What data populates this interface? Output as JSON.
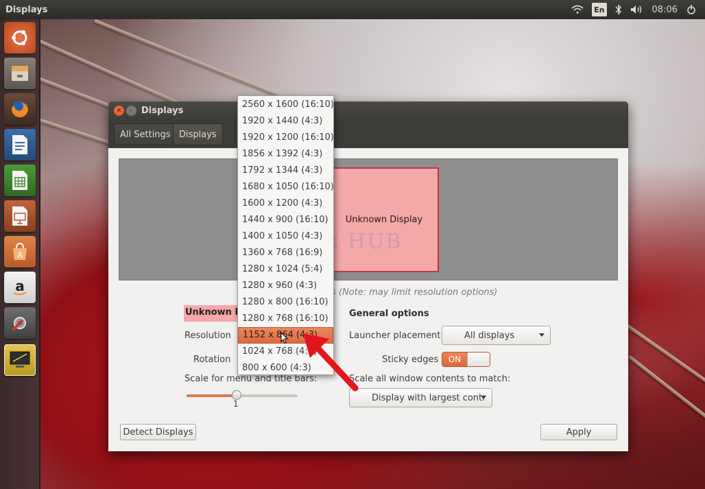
{
  "top_panel": {
    "title": "Displays",
    "language": "En",
    "clock": "08:06",
    "tray_icons": [
      "wifi-icon",
      "bluetooth-icon",
      "volume-icon",
      "settings-gear-icon"
    ]
  },
  "launcher": {
    "items": [
      "ubuntu-dash-icon",
      "files-icon",
      "firefox-icon",
      "writer-icon",
      "calc-icon",
      "impress-icon",
      "software-center-icon",
      "amazon-icon",
      "system-settings-icon",
      "displays-app-icon"
    ]
  },
  "window": {
    "title": "Displays",
    "breadcrumb": {
      "all_settings": "All Settings",
      "current": "Displays"
    },
    "monitor_label": "Unknown Display",
    "watermark": "IT Pros HUB",
    "note": "s (Note: may limit resolution options)",
    "display_name": "Unknown Di",
    "labels": {
      "resolution": "Resolution",
      "rotation": "Rotation",
      "scale_menu": "Scale for menu and title bars:",
      "scale_value": "1",
      "general_options": "General options",
      "launcher_placement": "Launcher placement",
      "sticky_edges": "Sticky edges",
      "scale_all": "Scale all window contents to match:"
    },
    "launcher_placement_value": "All displays",
    "sticky_edges_value": "ON",
    "scale_all_value": "Display with largest contr",
    "buttons": {
      "detect": "Detect Displays",
      "apply": "Apply"
    }
  },
  "resolution_dropdown": {
    "options": [
      "2560 x 1600 (16:10)",
      "1920 x 1440 (4:3)",
      "1920 x 1200 (16:10)",
      "1856 x 1392 (4:3)",
      "1792 x 1344 (4:3)",
      "1680 x 1050 (16:10)",
      "1600 x 1200 (4:3)",
      "1440 x 900 (16:10)",
      "1400 x 1050 (4:3)",
      "1360 x 768 (16:9)",
      "1280 x 1024 (5:4)",
      "1280 x 960 (4:3)",
      "1280 x 800 (16:10)",
      "1280 x 768 (16:10)",
      "1152 x 864 (4:3)",
      "1024 x 768 (4:3)",
      "800 x 600 (4:3)"
    ],
    "selected_index": 14
  },
  "colors": {
    "accent": "#dd6b3e",
    "monitor_fill": "#f4a8a8",
    "annotation_arrow": "#e3141e"
  }
}
